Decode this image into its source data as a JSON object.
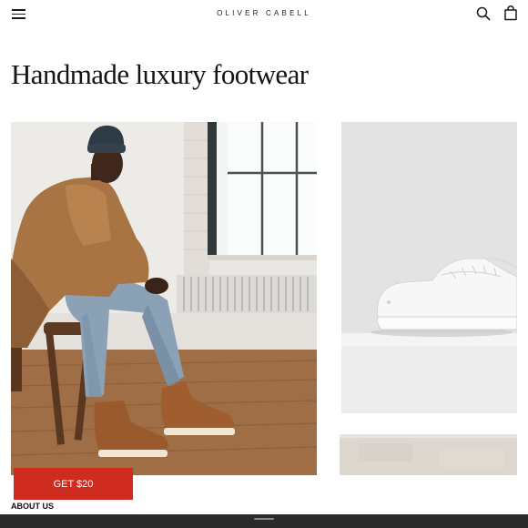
{
  "header": {
    "brand": "OLIVER CABELL",
    "menu_icon": "hamburger-menu-icon",
    "search_icon": "search-icon",
    "cart_icon": "shopping-bag-icon"
  },
  "main": {
    "title": "Handmade luxury footwear",
    "hero_image": "man-in-camel-jacket-and-brown-suede-boots-photo",
    "product_image": "white-leather-sneaker-photo",
    "product_image_2": "stone-pedestal-photo"
  },
  "promo": {
    "cta_label": "GET $20",
    "color": "#cf2b1e"
  },
  "footer": {
    "about_label": "ABOUT US"
  }
}
